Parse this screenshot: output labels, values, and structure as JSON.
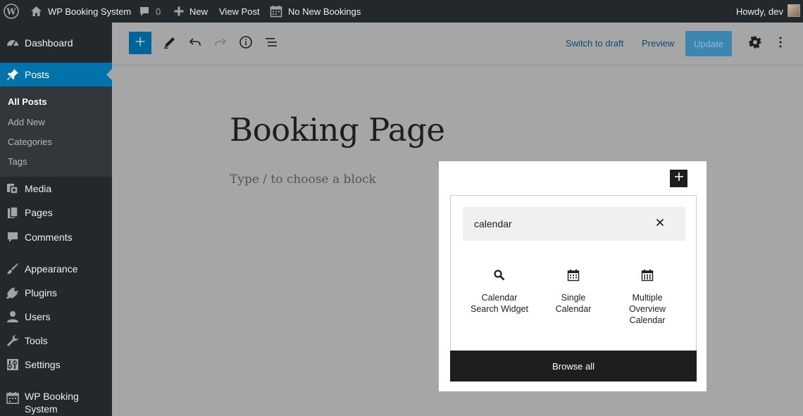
{
  "admin_bar": {
    "site_name": "WP Booking System",
    "comments_count": "0",
    "new_label": "New",
    "view_post_label": "View Post",
    "bookings_label": "No New Bookings",
    "greeting": "Howdy, dev"
  },
  "sidebar": {
    "items": [
      {
        "label": "Dashboard",
        "icon": "dashboard-icon"
      },
      {
        "label": "Posts",
        "icon": "pin-icon"
      },
      {
        "label": "Media",
        "icon": "media-icon"
      },
      {
        "label": "Pages",
        "icon": "pages-icon"
      },
      {
        "label": "Comments",
        "icon": "comments-icon"
      },
      {
        "label": "Appearance",
        "icon": "brush-icon"
      },
      {
        "label": "Plugins",
        "icon": "plug-icon"
      },
      {
        "label": "Users",
        "icon": "user-icon"
      },
      {
        "label": "Tools",
        "icon": "wrench-icon"
      },
      {
        "label": "Settings",
        "icon": "settings-icon"
      },
      {
        "label": "WP Booking System",
        "icon": "calendar-icon"
      }
    ],
    "posts_submenu": [
      "All Posts",
      "Add New",
      "Categories",
      "Tags"
    ]
  },
  "editor_header": {
    "switch_to_draft": "Switch to draft",
    "preview": "Preview",
    "update": "Update"
  },
  "post": {
    "title": "Booking Page",
    "placeholder": "Type / to choose a block"
  },
  "inserter": {
    "search_value": "calendar",
    "blocks": [
      {
        "label": "Calendar Search Widget",
        "icon": "search-icon"
      },
      {
        "label": "Single Calendar",
        "icon": "calendar-icon"
      },
      {
        "label": "Multiple Overview Calendar",
        "icon": "calendar-grid-icon"
      }
    ],
    "browse_all": "Browse all"
  },
  "colors": {
    "admin_bar": "#23282d",
    "active_menu": "#0073aa",
    "primary_button": "#006499",
    "overlay": "#a7a6a7"
  }
}
